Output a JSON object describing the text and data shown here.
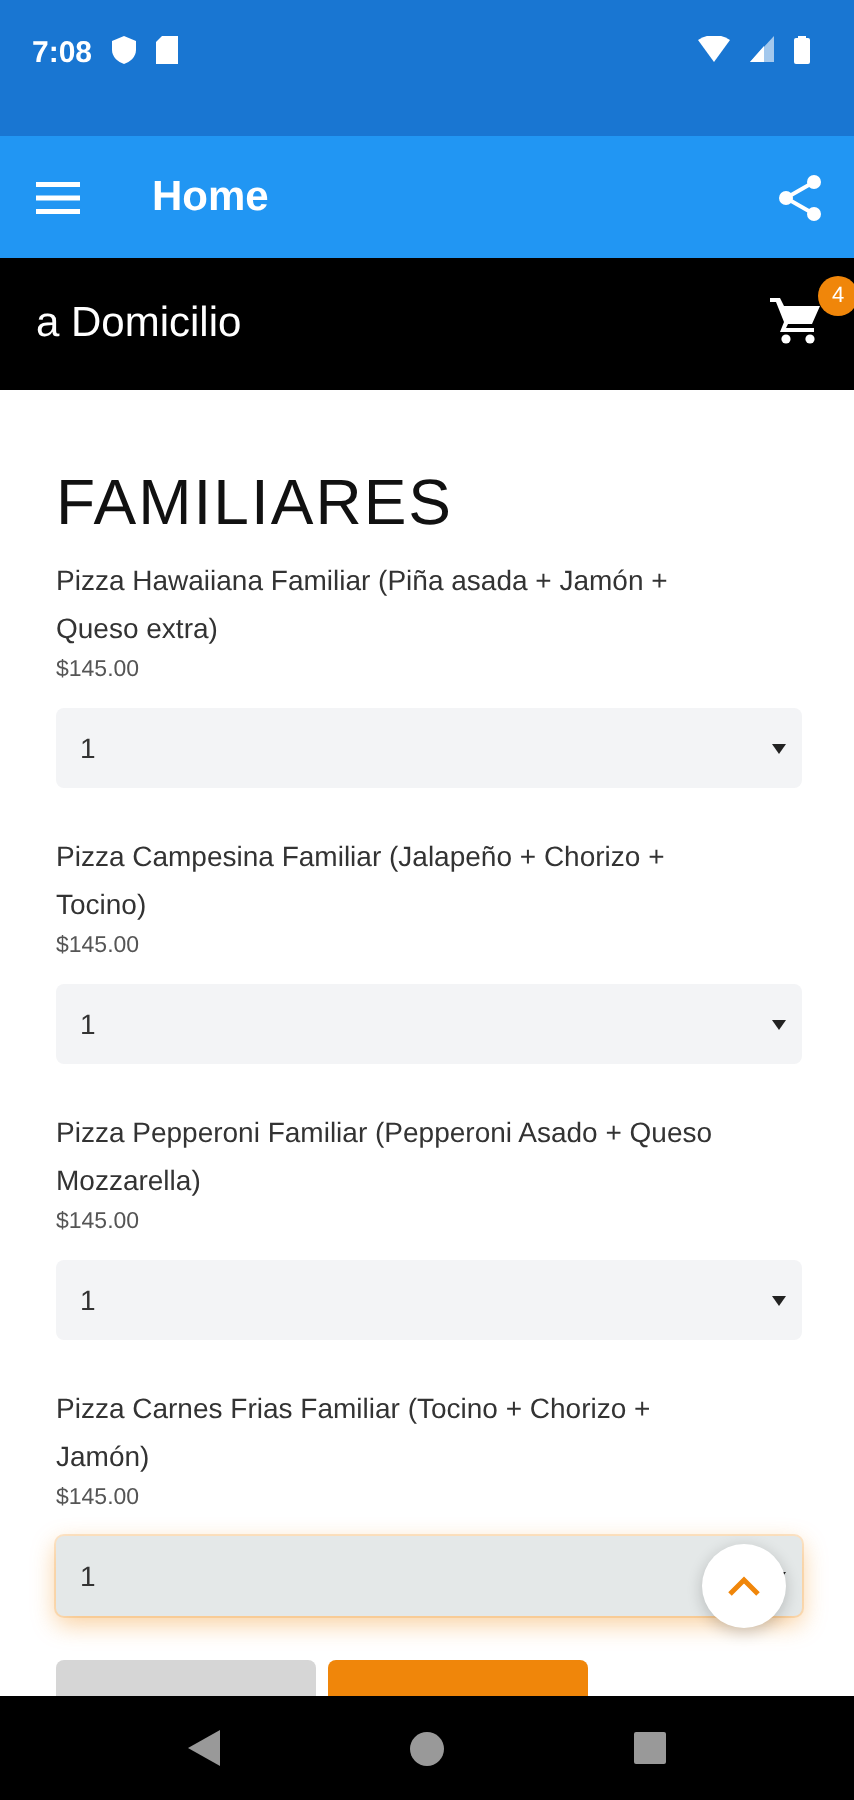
{
  "status_bar": {
    "time": "7:08"
  },
  "app_bar": {
    "title": "Home"
  },
  "sub_bar": {
    "title": "a Domicilio",
    "cart_count": "4"
  },
  "section": {
    "title": "FAMILIARES"
  },
  "products": [
    {
      "name": "Pizza Hawaiiana Familiar (Piña asada + Jamón + Queso extra)",
      "price": "$145.00",
      "quantity": "1",
      "focused": false
    },
    {
      "name": "Pizza Campesina Familiar (Jalapeño + Chorizo + Tocino)",
      "price": "$145.00",
      "quantity": "1",
      "focused": false
    },
    {
      "name": "Pizza Pepperoni Familiar (Pepperoni Asado + Queso Mozzarella)",
      "price": "$145.00",
      "quantity": "1",
      "focused": false
    },
    {
      "name": "Pizza Carnes Frias Familiar (Tocino + Chorizo + Jamón)",
      "price": "$145.00",
      "quantity": "1",
      "focused": true
    }
  ]
}
